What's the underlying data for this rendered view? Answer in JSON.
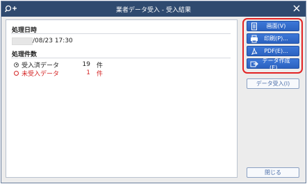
{
  "window": {
    "title": "業者データ受入 - 受入結果"
  },
  "processing_datetime": {
    "heading": "処理日時",
    "value": "/08/23 17:30"
  },
  "processing_count": {
    "heading": "処理件数",
    "rows": [
      {
        "label": "受入済データ",
        "count": "19",
        "unit": "件",
        "selected": true
      },
      {
        "label": "未受入データ",
        "count": "1",
        "unit": "件",
        "selected": false
      }
    ]
  },
  "actions": {
    "screen_label": "画面(V)",
    "print_label": "印刷(P)...",
    "pdf_label": "PDF(E)...",
    "create_data_label": "データ作成(E)...",
    "import_data_label": "データ受入(I)",
    "close_label": "閉じる"
  },
  "icons": {
    "title_icon": "search-plus-icon",
    "screen": "document-icon",
    "print": "printer-icon",
    "pdf": "pdf-icon",
    "create_data": "export-icon"
  },
  "colors": {
    "titlebar": "#2f4a6f",
    "primary_button": "#2c62c0",
    "highlight_border": "#e32222",
    "error_text": "#d42323"
  }
}
